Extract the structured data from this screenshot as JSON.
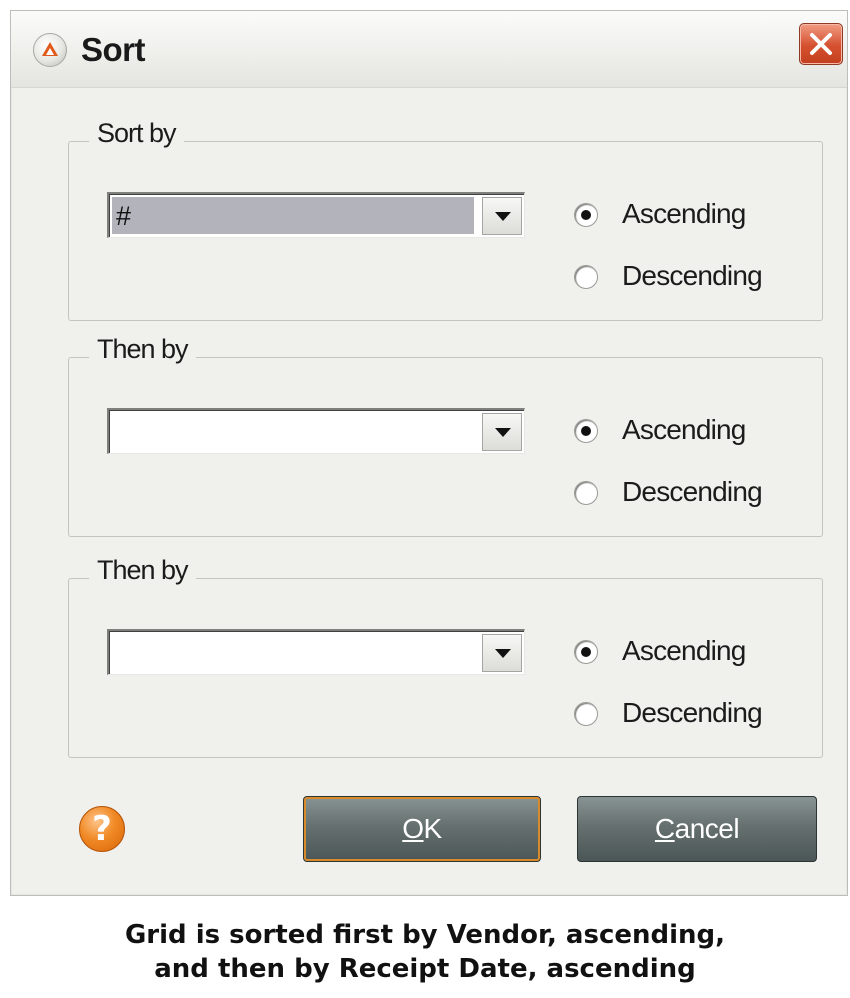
{
  "window": {
    "title": "Sort",
    "close_glyph": "✕"
  },
  "groups": [
    {
      "label": "Sort by",
      "combo_value": "#",
      "ascending_label": "Ascending",
      "descending_label": "Descending",
      "selected_order": "Ascending"
    },
    {
      "label": "Then by",
      "combo_value": "",
      "ascending_label": "Ascending",
      "descending_label": "Descending",
      "selected_order": "Ascending"
    },
    {
      "label": "Then by",
      "combo_value": "",
      "ascending_label": "Ascending",
      "descending_label": "Descending",
      "selected_order": "Ascending"
    }
  ],
  "footer": {
    "help_glyph": "?",
    "ok_mnemonic": "O",
    "ok_rest": "K",
    "cancel_mnemonic": "C",
    "cancel_rest": "ancel"
  },
  "caption": {
    "line1": "Grid is sorted first by Vendor, ascending,",
    "line2": "and then by Receipt Date, ascending"
  },
  "colors": {
    "dialog_bg": "#f0f0ed",
    "button_bg": "#65706f",
    "close_red": "#d5502f",
    "help_orange": "#f08a26",
    "selection_gray": "#b3b3bc"
  }
}
